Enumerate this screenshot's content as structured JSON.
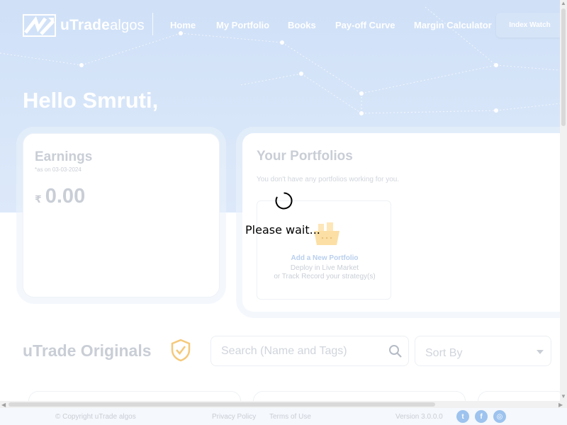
{
  "header": {
    "logo": {
      "brand": "uTrade",
      "suffix": "algos"
    },
    "nav": [
      {
        "label": "Home"
      },
      {
        "label": "My Portfolio"
      },
      {
        "label": "Books"
      },
      {
        "label": "Pay-off Curve"
      },
      {
        "label": "Margin Calculator"
      }
    ],
    "index_watch_label": "Index Watch"
  },
  "greeting": "Hello Smruti,",
  "earnings": {
    "title": "Earnings",
    "subtitle": "*as on 03-03-2024",
    "currency_symbol": "₹",
    "value": "0.00"
  },
  "portfolios": {
    "title": "Your Portfolios",
    "empty_message": "You don't have any portfolios working for you.",
    "add_card": {
      "label": "Add a New Portfolio",
      "line1": "Deploy in Live Market",
      "line2": "or Track Record your strategy(s)",
      "icon": "basket-icon"
    }
  },
  "loading": {
    "message": "Please wait..."
  },
  "originals": {
    "title": "uTrade Originals",
    "badge_icon": "shield-check-icon",
    "search_placeholder": "Search (Name and Tags)",
    "sort_label": "Sort By"
  },
  "footer": {
    "copyright": "© Copyright uTrade algos",
    "privacy": "Privacy Policy",
    "terms": "Terms of Use",
    "version": "Version 3.0.0.0",
    "social": [
      {
        "icon": "twitter-icon"
      },
      {
        "icon": "facebook-icon"
      },
      {
        "icon": "instagram-icon"
      }
    ]
  },
  "colors": {
    "hero_bg": "#cfe0f7",
    "muted_text": "#c9ced6",
    "accent_link": "#b9cfee",
    "social_blue": "#9dc3ee",
    "badge_orange": "#f5c97a"
  }
}
